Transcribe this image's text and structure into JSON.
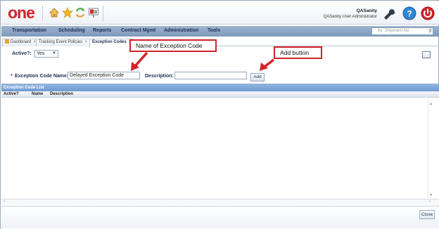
{
  "header": {
    "logo": "one",
    "user_name": "QASanity",
    "user_role": "QASanity User Administrator"
  },
  "nav": {
    "items": [
      "Transportation",
      "Scheduling",
      "Reports",
      "Contract Mgmt",
      "Administration",
      "Tools"
    ],
    "search_placeholder": "by: Shipment No"
  },
  "tabs": [
    {
      "label": "Dashboard"
    },
    {
      "label": "Tracking Event Policies"
    },
    {
      "label": "Exception Codes"
    }
  ],
  "filter": {
    "active_label": "Active?:",
    "active_value": "Yes"
  },
  "form": {
    "required_mark": "*",
    "code_label": "Exception Code Name:",
    "code_value": "Delayed Exception Code",
    "description_label": "Description:",
    "description_value": "",
    "add_label": "Add"
  },
  "grid": {
    "title": "Exception Code List",
    "columns": [
      "Active?",
      "Name",
      "Description"
    ]
  },
  "footer": {
    "close_label": "Close"
  },
  "callouts": {
    "code_name": "Name of Exception Code",
    "add": "Add button"
  },
  "colors": {
    "brand": "#d2232a",
    "nav": "#8aa4c4",
    "grid_header": "#7aa3d6"
  }
}
